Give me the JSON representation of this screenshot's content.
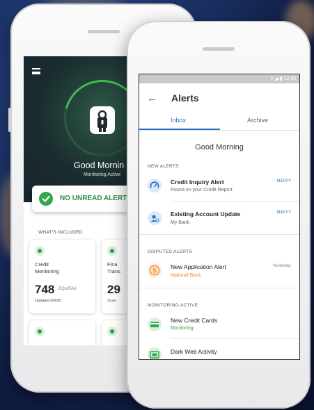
{
  "back_phone": {
    "greeting": "Good Mornin",
    "status": "Monitoring Active",
    "unread_label": "NO UNREAD ALERTS",
    "section_label": "WHAT'S INCLUDED",
    "tiles": [
      {
        "title_line1": "Credit",
        "title_line2": "Monitoring",
        "score": "748",
        "bureau": "EQUIFAX",
        "updated": "Updated 6/9/20"
      },
      {
        "title_line1": "Fina",
        "title_line2": "Trans",
        "score": "29",
        "sub": "Scan"
      }
    ]
  },
  "front_phone": {
    "status_time": "12:30",
    "title": "Alerts",
    "tabs": [
      {
        "label": "Inbox",
        "active": true
      },
      {
        "label": "Archive",
        "active": false
      }
    ],
    "greeting": "Good Morning",
    "sections": [
      {
        "label": "NEW ALERTS",
        "items": [
          {
            "title": "Credit Inquiry Alert",
            "subtitle": "Found on your Credit Report",
            "date": "M/D/YY",
            "icon": "gauge-icon"
          },
          {
            "title": "Existing Account Update",
            "subtitle": "My Bank",
            "date": "M/D/YY",
            "icon": "user-gear-icon"
          }
        ]
      },
      {
        "label": "DISPUTED ALERTS",
        "items": [
          {
            "title": "New Application Alert",
            "subtitle": "National Bank",
            "date": "Yesterday",
            "icon": "dollar-icon"
          }
        ]
      },
      {
        "label": "MONITORING ACTIVE",
        "items": [
          {
            "title": "New Credit Cards",
            "subtitle": "Monitoring",
            "icon": "credit-card-icon"
          },
          {
            "title": "Dark Web Activity",
            "subtitle": "",
            "icon": "web-icon"
          }
        ]
      }
    ]
  },
  "colors": {
    "primary_blue": "#2a73c2",
    "green": "#33a74a",
    "orange": "#f08a24",
    "date_blue": "#2a73c2"
  }
}
